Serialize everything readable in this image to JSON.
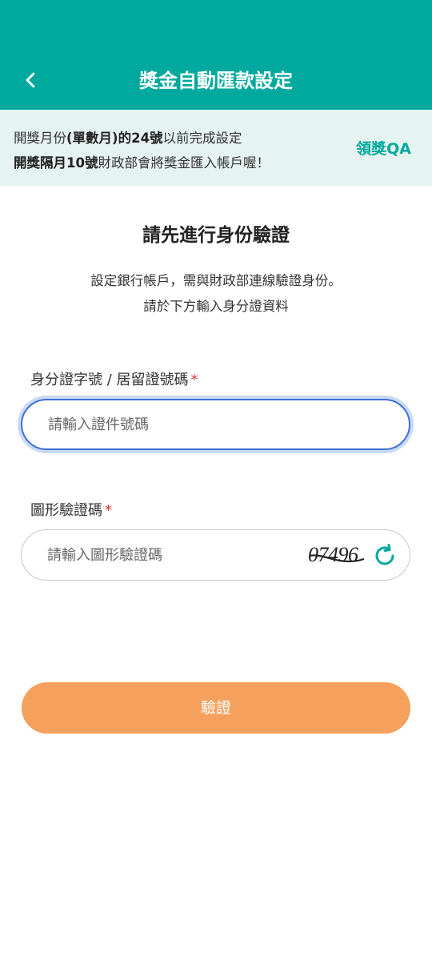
{
  "header": {
    "title": "獎金自動匯款設定",
    "back_icon": "chevron-left-icon",
    "background_color": "#00a99d"
  },
  "notice": {
    "line1_prefix": "開獎月份",
    "line1_bold": "(單數月)的24號",
    "line1_suffix": "以前完成設定",
    "line2_bold": "開獎隔月10號",
    "line2_suffix": "財政部會將獎金匯入帳戶喔！",
    "background_color": "#e6f4f1"
  },
  "qa_link": {
    "label": "領獎QA",
    "color": "#00a99d"
  },
  "main": {
    "title": "請先進行身份驗證",
    "desc_line1": "設定銀行帳戶，需與財政部連線驗證身份。",
    "desc_line2": "請於下方輸入身分證資料"
  },
  "id_field": {
    "label": "身分證字號 / 居留證號碼",
    "required_mark": "*",
    "placeholder": "請輸入證件號碼",
    "value": ""
  },
  "captcha_field": {
    "label": "圖形驗證碼",
    "required_mark": "*",
    "placeholder": "請輸入圖形驗證碼",
    "value": "",
    "captcha_image_text": "07496",
    "refresh_icon": "refresh-icon"
  },
  "verify_button": {
    "label": "驗證",
    "color": "#f5a15d"
  }
}
